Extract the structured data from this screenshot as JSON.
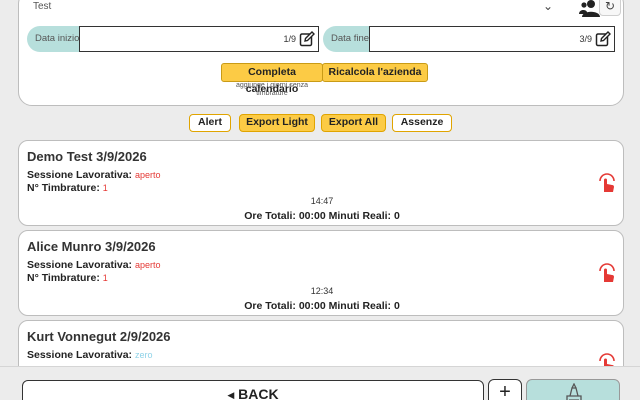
{
  "filters": {
    "company": "Test",
    "start_label": "Data inizio",
    "start_value": "1/9",
    "end_label": "Data fine",
    "end_value": "3/9",
    "complete_calendar_label": "Completa calendario",
    "complete_calendar_hint": "aggiunge i giorni senza timbrature",
    "recalc_label": "Ricalcola l'azienda"
  },
  "actions": {
    "alert": "Alert",
    "export_light": "Export Light",
    "export_all": "Export All",
    "absences": "Assenze"
  },
  "labels": {
    "session": "Sessione Lavorativa:",
    "stamps": "N° Timbrature:"
  },
  "sessions": [
    {
      "title": "Demo Test 3/9/2026",
      "status": "aperto",
      "stamps": "1",
      "time": "14:47",
      "totals": "Ore Totali: 00:00 Minuti Reali: 0"
    },
    {
      "title": "Alice Munro 3/9/2026",
      "status": "aperto",
      "stamps": "1",
      "time": "12:34",
      "totals": "Ore Totali: 00:00 Minuti Reali: 0"
    },
    {
      "title": "Kurt Vonnegut 2/9/2026",
      "status": "zero"
    }
  ],
  "footer": {
    "back_label": "BACK",
    "add_label": "+"
  },
  "colors": {
    "accent_yellow": "#fccb45",
    "teal": "#b7dfdc",
    "status_red": "#e53935"
  }
}
